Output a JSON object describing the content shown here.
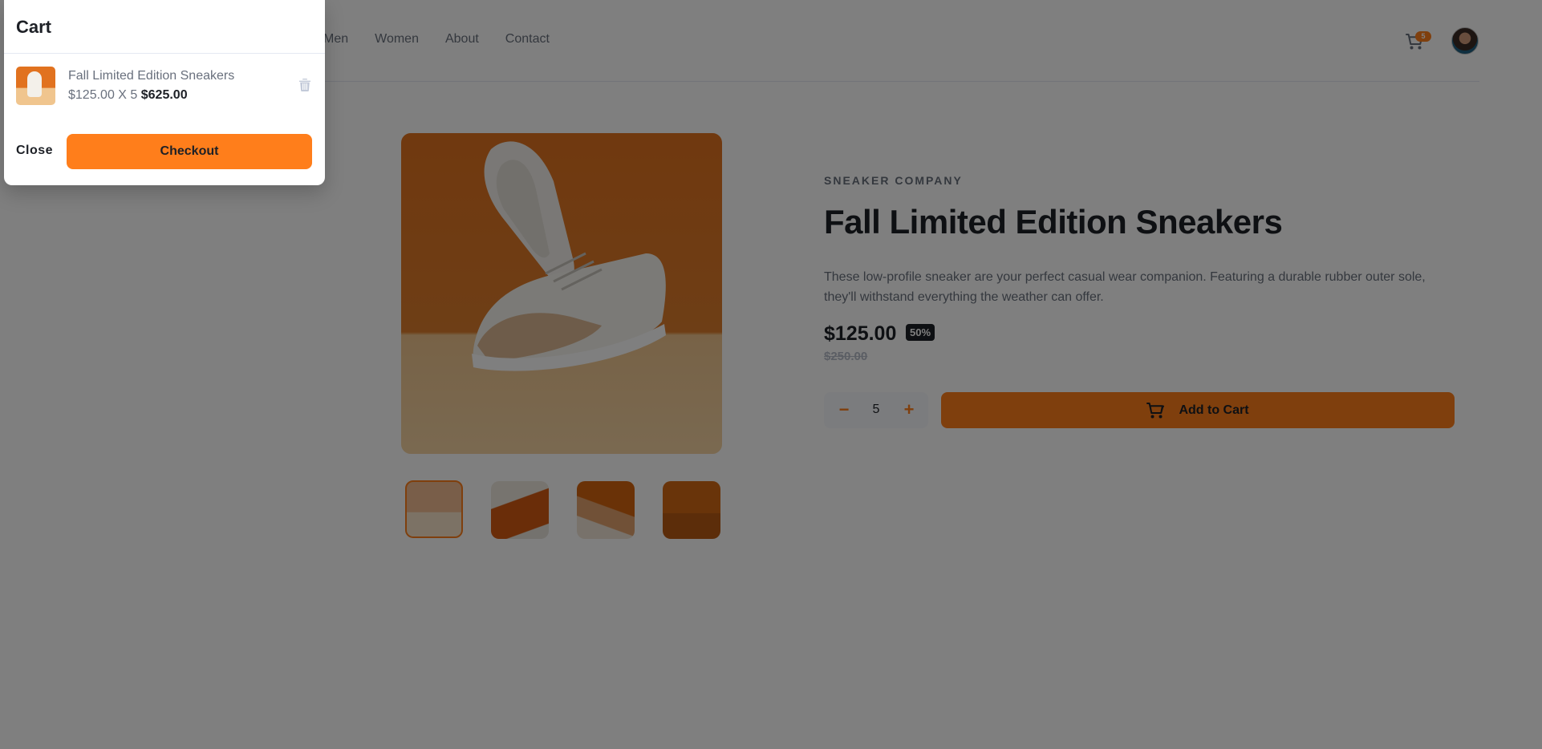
{
  "nav": {
    "items": [
      "Men",
      "Women",
      "About",
      "Contact"
    ]
  },
  "header": {
    "cart_count": "5"
  },
  "product": {
    "company": "SNEAKER COMPANY",
    "title": "Fall Limited Edition Sneakers",
    "description": "These low-profile sneaker are your perfect casual wear companion. Featuring a durable rubber outer sole, they'll withstand everything the weather can offer.",
    "price": "$125.00",
    "discount": "50%",
    "old_price": "$250.00",
    "quantity": "5",
    "add_to_cart_label": "Add to Cart"
  },
  "cart": {
    "title": "Cart",
    "item": {
      "name": "Fall Limited Edition Sneakers",
      "calc": "$125.00 X 5 ",
      "total": "$625.00"
    },
    "close_label": "Close",
    "checkout_label": "Checkout"
  },
  "colors": {
    "accent": "#ff7e1b",
    "dark": "#1d2026",
    "muted": "#69707d"
  },
  "icons": [
    "cart-icon",
    "avatar",
    "minus-icon",
    "plus-icon",
    "trash-icon"
  ]
}
